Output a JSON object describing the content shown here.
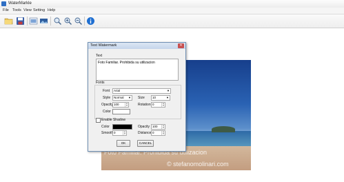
{
  "app": {
    "title": "WaterMarkle"
  },
  "menu": [
    "File",
    "Tools",
    "View",
    "Setting",
    "Help"
  ],
  "toolbar": {
    "icons": [
      "open-folder-icon",
      "save-icon",
      "image-icon",
      "image-edit-icon",
      "zoom-fit-icon",
      "zoom-in-icon",
      "zoom-out-icon",
      "info-icon"
    ]
  },
  "photo": {
    "watermark_line1": "Foto Familiar. Prohibida su utilizacion",
    "watermark_line2": "© stefanomolinari.com"
  },
  "dialog": {
    "title": "Text Watermark",
    "text_group": "Text",
    "text_value": "Foto Familiar. Prohibida su utilizacion",
    "fonts_group": "Fonts",
    "font_label": "Font",
    "font_value": "Arial",
    "style_label": "Style",
    "style_value": "Normal",
    "size_label": "Size",
    "size_value": "10",
    "opacity_label": "Opacity",
    "opacity_value": "100",
    "rotation_label": "Rotation",
    "rotation_value": "0",
    "color_label": "Color",
    "text_color": "#ffffff",
    "shadow_label": "Enable Shadow",
    "shadow_enabled": false,
    "shadow_color_label": "Color",
    "shadow_color": "#000000",
    "shadow_opacity_label": "Opacity",
    "shadow_opacity_value": "100",
    "smooth_label": "Smooth",
    "smooth_value": "0",
    "distance_label": "Distance",
    "distance_value": "0",
    "ok_label": "OK",
    "cancel_label": "CANCEL"
  }
}
